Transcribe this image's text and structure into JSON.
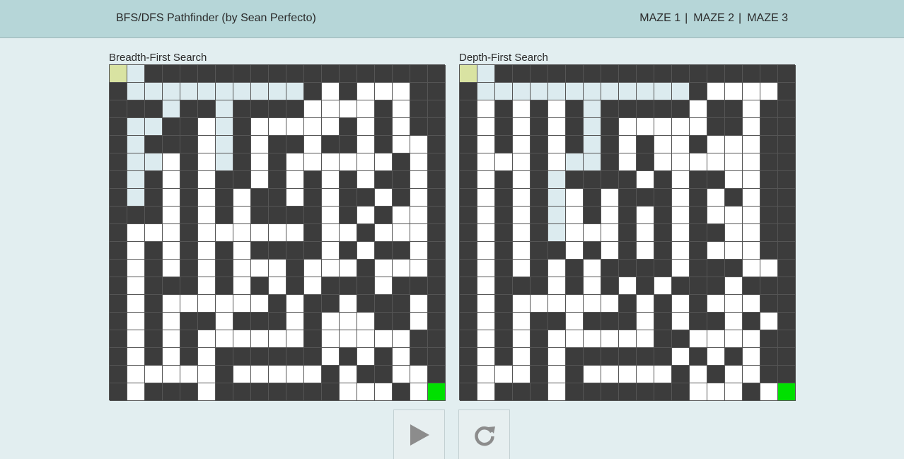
{
  "header": {
    "title": "BFS/DFS Pathfinder (by Sean Perfecto)",
    "mazes": [
      "MAZE 1",
      "MAZE 2",
      "MAZE 3"
    ],
    "separator": "|"
  },
  "panels": {
    "bfs": {
      "title": "Breadth-First Search",
      "rows": [
        "SP#################",
        "#PPPPPPPPPP#.#...##",
        "###P##P####....#.##",
        "#PP##.P#.....#.#.##",
        "#P###.P#.##.##.#..#",
        "#PP.#.P#.#......#.#",
        "#P#.#.##.#.#.#.##.#",
        "#P#.#.#.##.#.##.#.#",
        "###.#.#.####.#.#..#",
        "#...#......#..#...#",
        "#.#.#.#.####.#.##.#",
        "#.#.#.#...#...#...#",
        "#.###.#.#.#.###.###",
        "#.#......#.##.###.#",
        "#.#.##.###.#...##.#",
        "#.#.#......#.....##",
        "#.#.#.######.#.#.##",
        "#.....#.....#.##..#",
        "#.###.#######...#.G"
      ]
    },
    "dfs": {
      "title": "Depth-First Search",
      "rows": [
        "SP#################",
        "#PPPPPPPPPPPP#....#",
        "#.#.#.#P#####.##.##",
        "#.#.#.#P#.....##.##",
        "#.#.#.#P#.#..#...##",
        "#...#.PP#.#......##",
        "#.#.#P####.#.##..##",
        "#.#.#P.#.###.#.#.##",
        "#.#.#P.#.#.#.#...##",
        "#.#.#P...#.#.##..##",
        "#.#.##.#.#.#.#...##",
        "#.#.#.#.####.###..#",
        "#.###.#.#.#.###.###",
        "#.#......#.#.#...##",
        "#.#.##.###.#.##.#.#",
        "#.#.#......##....##",
        "#.#.#.######.#.#.##",
        "#...#.#.....#.#..##",
        "#.###.#######...#.G"
      ]
    }
  },
  "legend": {
    "wall_color": "#3c3c3c",
    "open_color": "#ffffff",
    "path_color": "#dcebef",
    "start_color": "#d9e3a2",
    "goal_color": "#00e000"
  },
  "controls": {
    "play_icon": "play-icon",
    "reset_icon": "reset-icon"
  }
}
